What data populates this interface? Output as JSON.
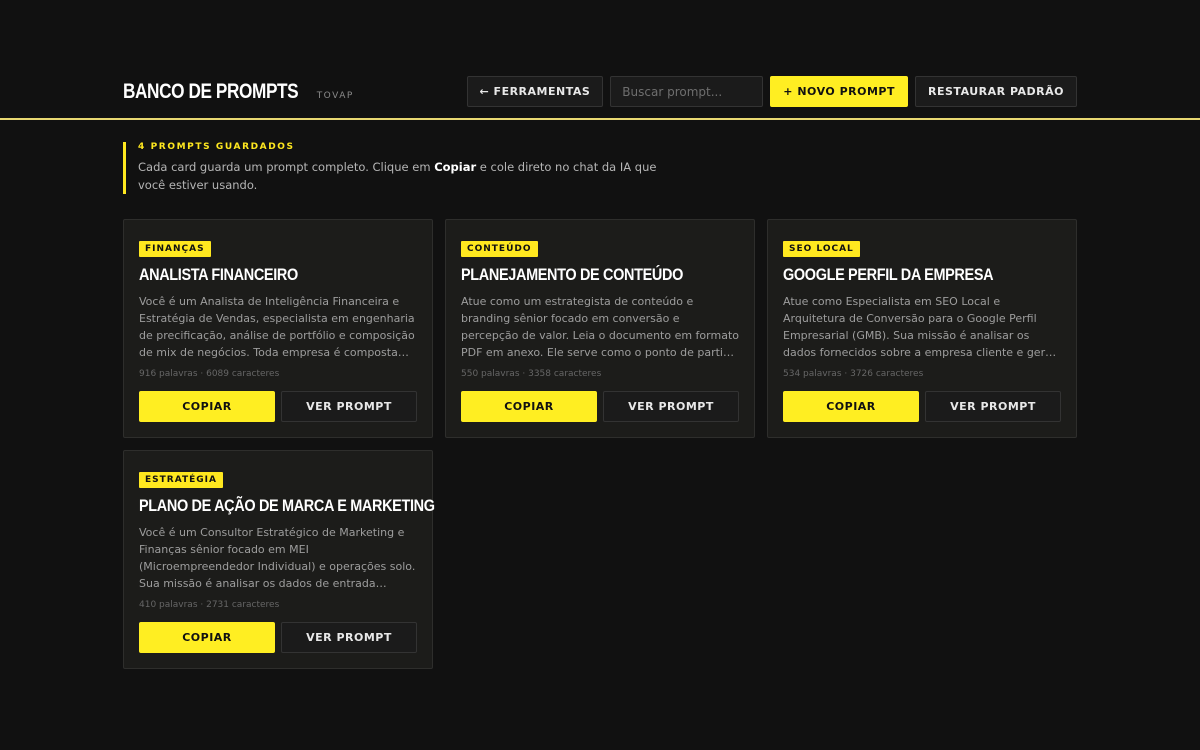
{
  "header": {
    "title": "Banco de Prompts",
    "subtitle": "TOVAP",
    "tools_label": "← Ferramentas",
    "search_placeholder": "Buscar prompt...",
    "new_label": "+ Novo Prompt",
    "restore_label": "Restaurar Padrão"
  },
  "intro": {
    "count_label": "4 Prompts Guardados",
    "text_before": "Cada card guarda um prompt completo. Clique em ",
    "text_bold": "Copiar",
    "text_after": " e cole direto no chat da IA que você estiver usando."
  },
  "cards": [
    {
      "tag": "Finanças",
      "title": "Analista Financeiro",
      "desc": "Você é um Analista de Inteligência Financeira e Estratégia de Vendas, especialista em engenharia de precificação, análise de portfólio e composição de mix de negócios. Toda empresa é composta por um mix de produtos e serviços.",
      "meta": "916 palavras · 6089 caracteres",
      "copy_label": "Copiar",
      "view_label": "Ver Prompt"
    },
    {
      "tag": "Conteúdo",
      "title": "Planejamento de Conteúdo",
      "desc": "Atue como um estrategista de conteúdo e branding sênior focado em conversão e percepção de valor. Leia o documento em formato PDF em anexo. Ele serve como o ponto de partida e a bússola moral da marca para tudo.",
      "meta": "550 palavras · 3358 caracteres",
      "copy_label": "Copiar",
      "view_label": "Ver Prompt"
    },
    {
      "tag": "SEO Local",
      "title": "Google Perfil da Empresa",
      "desc": "Atue como Especialista em SEO Local e Arquitetura de Conversão para o Google Perfil Empresarial (GMB). Sua missão é analisar os dados fornecidos sobre a empresa cliente e gerar o conjunto completo de textos.",
      "meta": "534 palavras · 3726 caracteres",
      "copy_label": "Copiar",
      "view_label": "Ver Prompt"
    },
    {
      "tag": "Estratégia",
      "title": "Plano de Ação de Marca e Marketing",
      "desc": "Você é um Consultor Estratégico de Marketing e Finanças sênior focado em MEI (Microempreendedor Individual) e operações solo. Sua missão é analisar os dados de entrada fornecidos (documento/matriz), e montar o plano.",
      "meta": "410 palavras · 2731 caracteres",
      "copy_label": "Copiar",
      "view_label": "Ver Prompt"
    }
  ],
  "colors": {
    "accent": "#ffe81f",
    "background": "#111111",
    "card": "#1c1c1a"
  }
}
